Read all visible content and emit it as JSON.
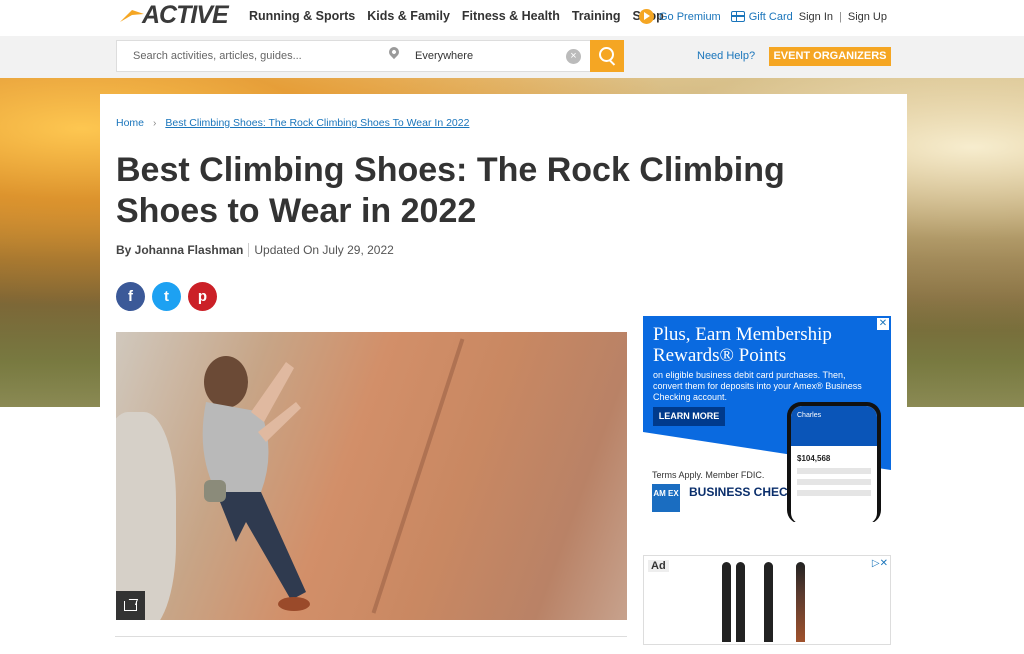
{
  "brand": {
    "logo_text": "ACTIVE",
    "accent_color": "#f5a623",
    "link_color": "#1a75bb"
  },
  "nav": {
    "items": [
      "Running & Sports",
      "Kids & Family",
      "Fitness & Health",
      "Training",
      "Shop"
    ],
    "go_premium": "Go Premium",
    "gift_card": "Gift Card",
    "sign_in": "Sign In",
    "separator": "|",
    "sign_up": "Sign Up"
  },
  "search": {
    "placeholder": "Search activities, articles, guides...",
    "location": "Everywhere",
    "clear_icon": "×",
    "need_help": "Need Help?",
    "event_organizers": "EVENT ORGANIZERS"
  },
  "breadcrumb": {
    "home": "Home",
    "chevron": "›",
    "current": "Best Climbing Shoes: The Rock Climbing Shoes To Wear In 2022"
  },
  "article": {
    "title": "Best Climbing Shoes: The Rock Climbing Shoes to Wear in 2022",
    "author": "By Johanna Flashman",
    "updated": "Updated On July 29, 2022",
    "social": {
      "facebook": "f",
      "twitter": "t",
      "pinterest": "p"
    }
  },
  "ad1": {
    "close": "✕",
    "headline": "Plus, Earn Membership Rewards® Points",
    "subtext": "on eligible business debit card purchases. Then, convert them for deposits into your Amex® Business Checking account.",
    "cta": "LEARN MORE",
    "terms": "Terms Apply. Member FDIC.",
    "logo": "AM EX",
    "product": "BUSINESS CHECKING",
    "phone_name": "Charles",
    "phone_balance": "$104,568"
  },
  "ad2": {
    "label": "Ad",
    "choices": "▷✕"
  }
}
